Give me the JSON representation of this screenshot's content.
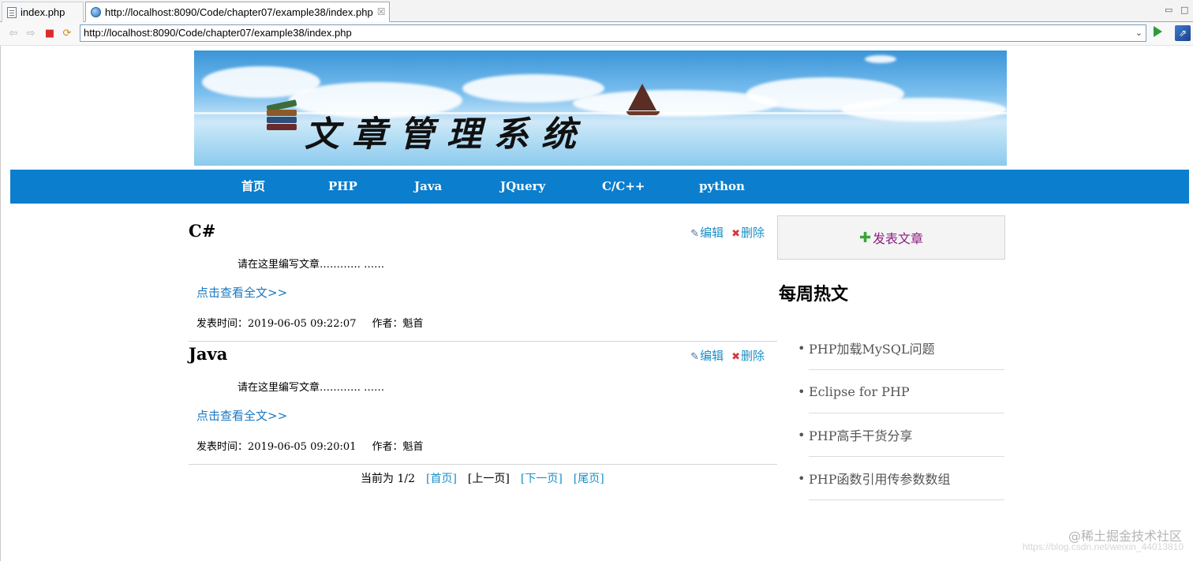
{
  "window": {
    "tabs": [
      {
        "label": "index.php",
        "icon": "php-file-icon"
      },
      {
        "label": "http://localhost:8090/Code/chapter07/example38/index.php",
        "icon": "globe-icon"
      }
    ],
    "close_glyph": "☒",
    "minimize_glyph": "▭",
    "maximize_glyph": "□"
  },
  "toolbar": {
    "back_glyph": "⇦",
    "forward_glyph": "⇨",
    "stop_glyph": "■",
    "refresh_glyph": "⟳",
    "url": "http://localhost:8090/Code/chapter07/example38/index.php",
    "dropdown_glyph": "⌄",
    "external_glyph": "⇗"
  },
  "banner": {
    "title": "文章管理系统"
  },
  "nav": {
    "items": [
      "首页",
      "PHP",
      "Java",
      "JQuery",
      "C/C++",
      "python"
    ]
  },
  "articles": [
    {
      "title": "C#",
      "edit_label": "编辑",
      "delete_label": "删除",
      "summary": "请在这里编写文章………… ……",
      "read_more": "点击查看全文>>",
      "published": "发表时间：2019-06-05 09:22:07",
      "author": "作者：魁首"
    },
    {
      "title": "Java",
      "edit_label": "编辑",
      "delete_label": "删除",
      "summary": "请在这里编写文章………… ……",
      "read_more": "点击查看全文>>",
      "published": "发表时间：2019-06-05 09:20:01",
      "author": "作者：魁首"
    }
  ],
  "pager": {
    "current": "当前为 1/2",
    "first": "[首页]",
    "prev": "[上一页]",
    "next": "[下一页]",
    "last": "[尾页]"
  },
  "sidebar": {
    "post_button": "发表文章",
    "hot_title": "每周热文",
    "hot_items": [
      "PHP加载MySQL问题",
      "Eclipse for PHP",
      "PHP高手干货分享",
      "PHP函数引用传参数数组"
    ]
  },
  "watermark": {
    "label": "@稀土掘金技术社区",
    "url": "https://blog.csdn.net/weixin_44013810"
  },
  "colors": {
    "nav_bg": "#0b7ecd",
    "link": "#1a8fc6",
    "post_button_text": "#8b1e7f"
  }
}
